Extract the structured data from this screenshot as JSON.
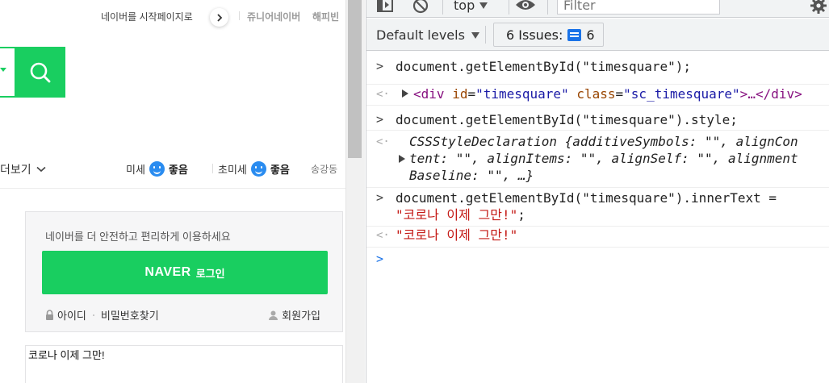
{
  "page": {
    "start_page_link": "네이버를 시작페이지로",
    "services": [
      "쥬니어네이버",
      "해피빈"
    ],
    "more_label": "더보기",
    "fine_dust_label": "미세",
    "fine_dust_value": "좋음",
    "ultra_dust_label": "초미세",
    "ultra_dust_value": "좋음",
    "region": "송강동",
    "login": {
      "description": "네이버를 더 안전하고 편리하게 이용하세요",
      "button_logo": "NAVER",
      "button_text": "로그인",
      "id_link": "아이디",
      "pw_link": "비밀번호찾기",
      "signup_link": "회원가입"
    },
    "timesquare_text": "코로나 이제 그만!"
  },
  "devtools": {
    "context": "top",
    "filter_placeholder": "Filter",
    "levels_label": "Default levels",
    "issues_label": "6 Issues:",
    "issues_count": "6",
    "console": [
      {
        "kind": "input",
        "code": "document.getElementById(\"timesquare\");"
      },
      {
        "kind": "output",
        "element_tag": "div",
        "element_id": "timesquare",
        "element_class": "sc_timesquare",
        "element_rest": "…</div>"
      },
      {
        "kind": "input",
        "code": "document.getElementById(\"timesquare\").style;"
      },
      {
        "kind": "output",
        "line1": "CSSStyleDeclaration {additiveSymbols: \"\", alignCon",
        "line2": "tent: \"\", alignItems: \"\", alignSelf: \"\", alignment",
        "line3": "Baseline: \"\", …}"
      },
      {
        "kind": "input",
        "line1_code": "document.getElementById(\"timesquare\").innerText =",
        "line2_string": "\"코로나 이제 그만!\"",
        "line2_end": ";"
      },
      {
        "kind": "output",
        "string": "\"코로나 이제 그만!\""
      }
    ]
  }
}
